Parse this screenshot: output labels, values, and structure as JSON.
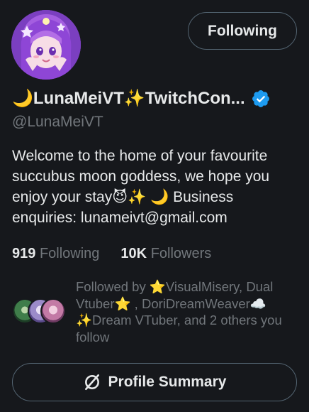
{
  "profile": {
    "display_name": "🌙LunaMeiVT✨TwitchCon...",
    "handle": "@LunaMeiVT",
    "verified_icon": "verified-badge-icon",
    "bio": "Welcome to the home of your favourite succubus moon goddess, we hope you enjoy your stay😈✨ 🌙 Business enquiries: lunameivt@gmail.com"
  },
  "actions": {
    "following_label": "Following",
    "summary_label": "Profile Summary",
    "summary_icon": "grok-icon"
  },
  "stats": {
    "following_count": "919",
    "following_label": "Following",
    "followers_count": "10K",
    "followers_label": "Followers"
  },
  "followed_by": {
    "text": "Followed by ⭐VisualMisery, Dual Vtuber⭐ , DoriDreamWeaver☁️✨Dream VTuber, and 2 others you follow"
  },
  "colors": {
    "background": "#16181c",
    "text_primary": "#e7e9ea",
    "text_secondary": "#71767b",
    "border": "#536471",
    "verified": "#1d9bf0"
  }
}
